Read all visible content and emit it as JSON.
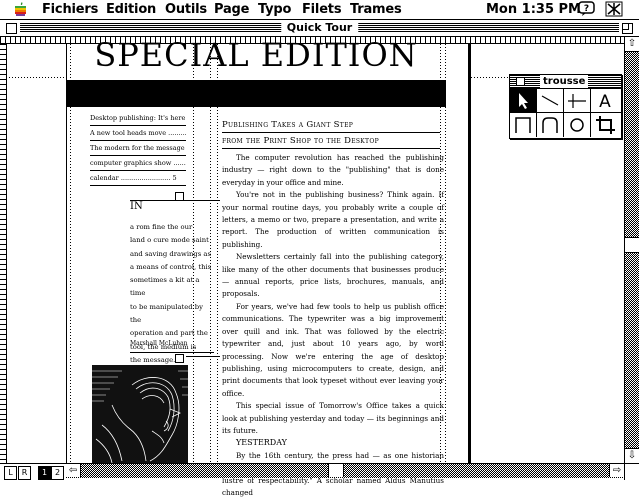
{
  "menubar": {
    "items": [
      "Fichiers",
      "Edition",
      "Outils",
      "Page",
      "Typo",
      "Filets",
      "Trames"
    ],
    "clock": "Mon 1:35 PM"
  },
  "window": {
    "title": "Quick Tour"
  },
  "document": {
    "masthead": "SPECIAL EDITION",
    "toc": [
      "Desktop publishing: It's here .... 1",
      "A new tool heads move ........... 2",
      "The modern for the message ...... 3",
      "computer graphics show .......... 5",
      "calendar ........................ 5"
    ],
    "sidebar_heading": "IN",
    "sidebar_lines": [
      "a rom fine the our",
      "land o cure mode saint",
      "and saving drawings as",
      "a means of control, this",
      "sometimes a kit at a time",
      "to be manipulated by the",
      "operation and part the",
      "tool, the medium is",
      "the message."
    ],
    "caption": "Marshall McLuhan",
    "article_heading_1": "Publishing Takes a Giant Step",
    "article_heading_2": "from the Print Shop to the Desktop",
    "article_paragraphs": [
      "The computer revolution has reached the publishing industry — right down to the \"publishing\" that is done everyday in your office and mine.",
      "You're not in the publishing business? Think again. If your normal routine days, you probably write a couple of letters, a memo or two, prepare a presentation, and write a report. The production of written communication is publishing.",
      "Newsletters certainly fall into the publishing category, like many of the other documents that businesses produce — annual reports, price lists, brochures, manuals, and proposals.",
      "For years, we've had few tools to help us publish office communications. The typewriter was a big improvement over quill and ink. That was followed by the electric typewriter and, just about 10 years ago, by word processing. Now we're entering the age of desktop publishing, using microcomputers to create, design, and print documents that look typeset without ever leaving your office.",
      "This special issue of Tomorrow's Office takes a quick look at publishing yesterday and today — its beginnings and its future."
    ],
    "subheading": "YESTERDAY",
    "article_tail": "By the 16th century, the press had — as one historian has noted — \"lost the sweet of novelty but retained the lustre of respectability.\" A scholar named Aldus Manutius changed"
  },
  "palette": {
    "title": "trousse",
    "tools": [
      "pointer-tool",
      "diagonal-line-tool",
      "perpendicular-line-tool",
      "text-tool",
      "square-corner-box-tool",
      "rounded-box-tool",
      "oval-tool",
      "crop-tool"
    ]
  },
  "pages": {
    "left": "L",
    "right": "R",
    "current": "1",
    "next": "2"
  }
}
